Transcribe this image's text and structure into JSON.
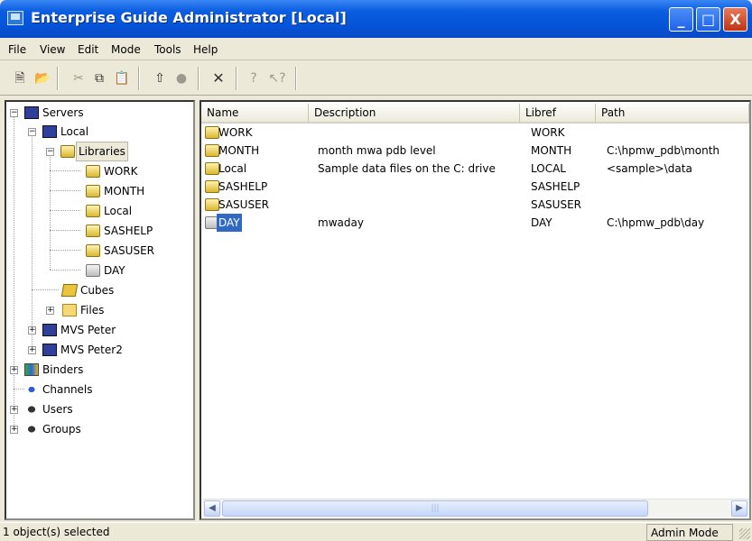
{
  "window": {
    "title": "Enterprise Guide Administrator [Local]",
    "controls": {
      "minimize": "_",
      "maximize": "□",
      "close": "X"
    }
  },
  "menu": [
    "File",
    "View",
    "Edit",
    "Mode",
    "Tools",
    "Help"
  ],
  "toolbar": {
    "tools": [
      {
        "name": "new-icon",
        "glyph": "🗎",
        "enabled": true
      },
      {
        "name": "open-icon",
        "glyph": "📂",
        "enabled": true
      },
      {
        "name": "cut-icon",
        "glyph": "✂",
        "enabled": false
      },
      {
        "name": "copy-icon",
        "glyph": "⧉",
        "enabled": true
      },
      {
        "name": "paste-icon",
        "glyph": "📋",
        "enabled": false
      },
      {
        "name": "up-folder-icon",
        "glyph": "⇧",
        "enabled": true
      },
      {
        "name": "record-icon",
        "glyph": "●",
        "enabled": false
      },
      {
        "name": "delete-icon",
        "glyph": "✕",
        "enabled": true
      },
      {
        "name": "help-icon",
        "glyph": "?",
        "enabled": false
      },
      {
        "name": "context-help-icon",
        "glyph": "↖?",
        "enabled": false
      }
    ]
  },
  "tree": {
    "servers": "Servers",
    "local": "Local",
    "libraries": "Libraries",
    "libs": [
      "WORK",
      "MONTH",
      "Local",
      "SASHELP",
      "SASUSER",
      "DAY"
    ],
    "cubes": "Cubes",
    "files": "Files",
    "mvs_peter": "MVS Peter",
    "mvs_peter2": "MVS Peter2",
    "binders": "Binders",
    "channels": "Channels",
    "users": "Users",
    "groups": "Groups"
  },
  "list": {
    "columns": [
      "Name",
      "Description",
      "Libref",
      "Path"
    ],
    "rows": [
      {
        "name": "WORK",
        "description": "",
        "libref": "WORK",
        "path": ""
      },
      {
        "name": "MONTH",
        "description": "month mwa pdb level",
        "libref": "MONTH",
        "path": "C:\\hpmw_pdb\\month"
      },
      {
        "name": "Local",
        "description": "Sample data files on the C: drive",
        "libref": "LOCAL",
        "path": "<sample>\\data"
      },
      {
        "name": "SASHELP",
        "description": "",
        "libref": "SASHELP",
        "path": ""
      },
      {
        "name": "SASUSER",
        "description": "",
        "libref": "SASUSER",
        "path": ""
      },
      {
        "name": "DAY",
        "description": "mwaday",
        "libref": "DAY",
        "path": "C:\\hpmw_pdb\\day"
      }
    ],
    "selected_row": "DAY"
  },
  "status": {
    "left": "1 object(s) selected",
    "right": "Admin Mode"
  },
  "colors": {
    "titlebar": "#0553d8",
    "selection": "#316ac5",
    "chrome": "#ece9d8"
  }
}
